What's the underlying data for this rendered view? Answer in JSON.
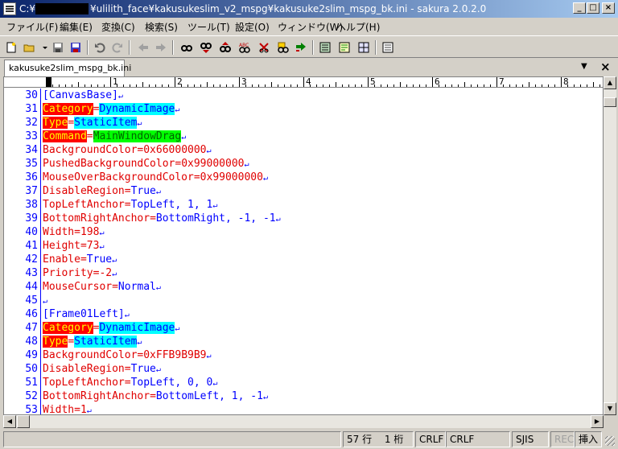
{
  "window": {
    "drive": "C:¥",
    "title": "¥ulilith_face¥kakusukeslim_v2_mspg¥kakusuke2slim_mspg_bk.ini - sakura 2.0.2.0",
    "minimize_label": "_",
    "maximize_label": "□",
    "close_label": "×"
  },
  "menu": [
    "ファイル(F)",
    "編集(E)",
    "変換(C)",
    "検索(S)",
    "ツール(T)",
    "設定(O)",
    "ウィンドウ(W)",
    "ヘルプ(H)"
  ],
  "tab": {
    "label": "kakusuke2slim_mspg_bk.ini",
    "arrow": "▼",
    "close": "×"
  },
  "ruler": [
    "1",
    "2",
    "3",
    "4",
    "5",
    "6",
    "7",
    "8"
  ],
  "lines": [
    {
      "n": "30",
      "tokens": [
        {
          "t": "[CanvasBase]",
          "c": "section"
        }
      ]
    },
    {
      "n": "31",
      "tokens": [
        {
          "t": "Category",
          "c": "hkey"
        },
        {
          "t": "=",
          "c": "eq"
        },
        {
          "t": "DynamicImage",
          "c": "hval"
        }
      ]
    },
    {
      "n": "32",
      "tokens": [
        {
          "t": "Type",
          "c": "hkey"
        },
        {
          "t": "=",
          "c": "eq"
        },
        {
          "t": "StaticItem",
          "c": "hval"
        }
      ]
    },
    {
      "n": "33",
      "tokens": [
        {
          "t": "Command",
          "c": "hkey"
        },
        {
          "t": "=",
          "c": "eq"
        },
        {
          "t": "MainWindowDrag",
          "c": "hvalg"
        }
      ]
    },
    {
      "n": "34",
      "tokens": [
        {
          "t": "BackgroundColor",
          "c": "key"
        },
        {
          "t": "=",
          "c": "eq"
        },
        {
          "t": "0x66000000",
          "c": "key"
        }
      ]
    },
    {
      "n": "35",
      "tokens": [
        {
          "t": "PushedBackgroundColor",
          "c": "key"
        },
        {
          "t": "=",
          "c": "eq"
        },
        {
          "t": "0x99000000",
          "c": "key"
        }
      ]
    },
    {
      "n": "36",
      "tokens": [
        {
          "t": "MouseOverBackgroundColor",
          "c": "key"
        },
        {
          "t": "=",
          "c": "eq"
        },
        {
          "t": "0x99000000",
          "c": "key"
        }
      ]
    },
    {
      "n": "37",
      "tokens": [
        {
          "t": "DisableRegion",
          "c": "key"
        },
        {
          "t": "=",
          "c": "eq"
        },
        {
          "t": "True",
          "c": "val"
        }
      ]
    },
    {
      "n": "38",
      "tokens": [
        {
          "t": "TopLeftAnchor",
          "c": "key"
        },
        {
          "t": "=",
          "c": "eq"
        },
        {
          "t": "TopLeft, 1, 1",
          "c": "val"
        }
      ]
    },
    {
      "n": "39",
      "tokens": [
        {
          "t": "BottomRightAnchor",
          "c": "key"
        },
        {
          "t": "=",
          "c": "eq"
        },
        {
          "t": "BottomRight, -1, -1",
          "c": "val"
        }
      ]
    },
    {
      "n": "40",
      "tokens": [
        {
          "t": "Width",
          "c": "key"
        },
        {
          "t": "=",
          "c": "eq"
        },
        {
          "t": "198",
          "c": "key"
        }
      ]
    },
    {
      "n": "41",
      "tokens": [
        {
          "t": "Height",
          "c": "key"
        },
        {
          "t": "=",
          "c": "eq"
        },
        {
          "t": "73",
          "c": "key"
        }
      ]
    },
    {
      "n": "42",
      "tokens": [
        {
          "t": "Enable",
          "c": "key"
        },
        {
          "t": "=",
          "c": "eq"
        },
        {
          "t": "True",
          "c": "val"
        }
      ]
    },
    {
      "n": "43",
      "tokens": [
        {
          "t": "Priority",
          "c": "key"
        },
        {
          "t": "=",
          "c": "eq"
        },
        {
          "t": "-2",
          "c": "key"
        }
      ]
    },
    {
      "n": "44",
      "tokens": [
        {
          "t": "MouseCursor",
          "c": "key"
        },
        {
          "t": "=",
          "c": "eq"
        },
        {
          "t": "Normal",
          "c": "val"
        }
      ]
    },
    {
      "n": "45",
      "tokens": []
    },
    {
      "n": "46",
      "tokens": [
        {
          "t": "[Frame01Left]",
          "c": "section"
        }
      ]
    },
    {
      "n": "47",
      "tokens": [
        {
          "t": "Category",
          "c": "hkey"
        },
        {
          "t": "=",
          "c": "eq"
        },
        {
          "t": "DynamicImage",
          "c": "hval"
        }
      ]
    },
    {
      "n": "48",
      "tokens": [
        {
          "t": "Type",
          "c": "hkey"
        },
        {
          "t": "=",
          "c": "eq"
        },
        {
          "t": "StaticItem",
          "c": "hval"
        }
      ]
    },
    {
      "n": "49",
      "tokens": [
        {
          "t": "BackgroundColor",
          "c": "key"
        },
        {
          "t": "=",
          "c": "eq"
        },
        {
          "t": "0xFFB9B9B9",
          "c": "key"
        }
      ]
    },
    {
      "n": "50",
      "tokens": [
        {
          "t": "DisableRegion",
          "c": "key"
        },
        {
          "t": "=",
          "c": "eq"
        },
        {
          "t": "True",
          "c": "val"
        }
      ]
    },
    {
      "n": "51",
      "tokens": [
        {
          "t": "TopLeftAnchor",
          "c": "key"
        },
        {
          "t": "=",
          "c": "eq"
        },
        {
          "t": "TopLeft, 0, 0",
          "c": "val"
        }
      ]
    },
    {
      "n": "52",
      "tokens": [
        {
          "t": "BottomRightAnchor",
          "c": "key"
        },
        {
          "t": "=",
          "c": "eq"
        },
        {
          "t": "BottomLeft, 1, -1",
          "c": "val"
        }
      ]
    },
    {
      "n": "53",
      "tokens": [
        {
          "t": "Width",
          "c": "key"
        },
        {
          "t": "=",
          "c": "eq"
        },
        {
          "t": "1",
          "c": "key"
        }
      ]
    }
  ],
  "eol_glyph": "↵",
  "status": {
    "position": "57 行　 1 桁",
    "eol1": "CRLF",
    "eol2": "CRLF",
    "encoding": "SJIS",
    "rec": "REC",
    "mode": "挿入"
  },
  "scroll": {
    "up": "▲",
    "down": "▼",
    "left": "◀",
    "right": "▶"
  },
  "colors": {
    "key": "#e00000",
    "section": "#0000ff",
    "highlight_key_bg": "#ff0000",
    "highlight_val_bg": "#00ffff",
    "highlight_cmd_bg": "#00ff00"
  },
  "toolbar_icons": [
    "new-file-icon",
    "open-folder-icon",
    "save-icon",
    "save-all-icon",
    "undo-icon",
    "redo-icon",
    "jump-back-icon",
    "jump-forward-icon",
    "find-icon",
    "find-prev-icon",
    "find-next-icon",
    "replace-icon",
    "bookmark-icon",
    "grep-icon",
    "compare-icon",
    "outline-icon",
    "external-icon",
    "settings-icon"
  ]
}
